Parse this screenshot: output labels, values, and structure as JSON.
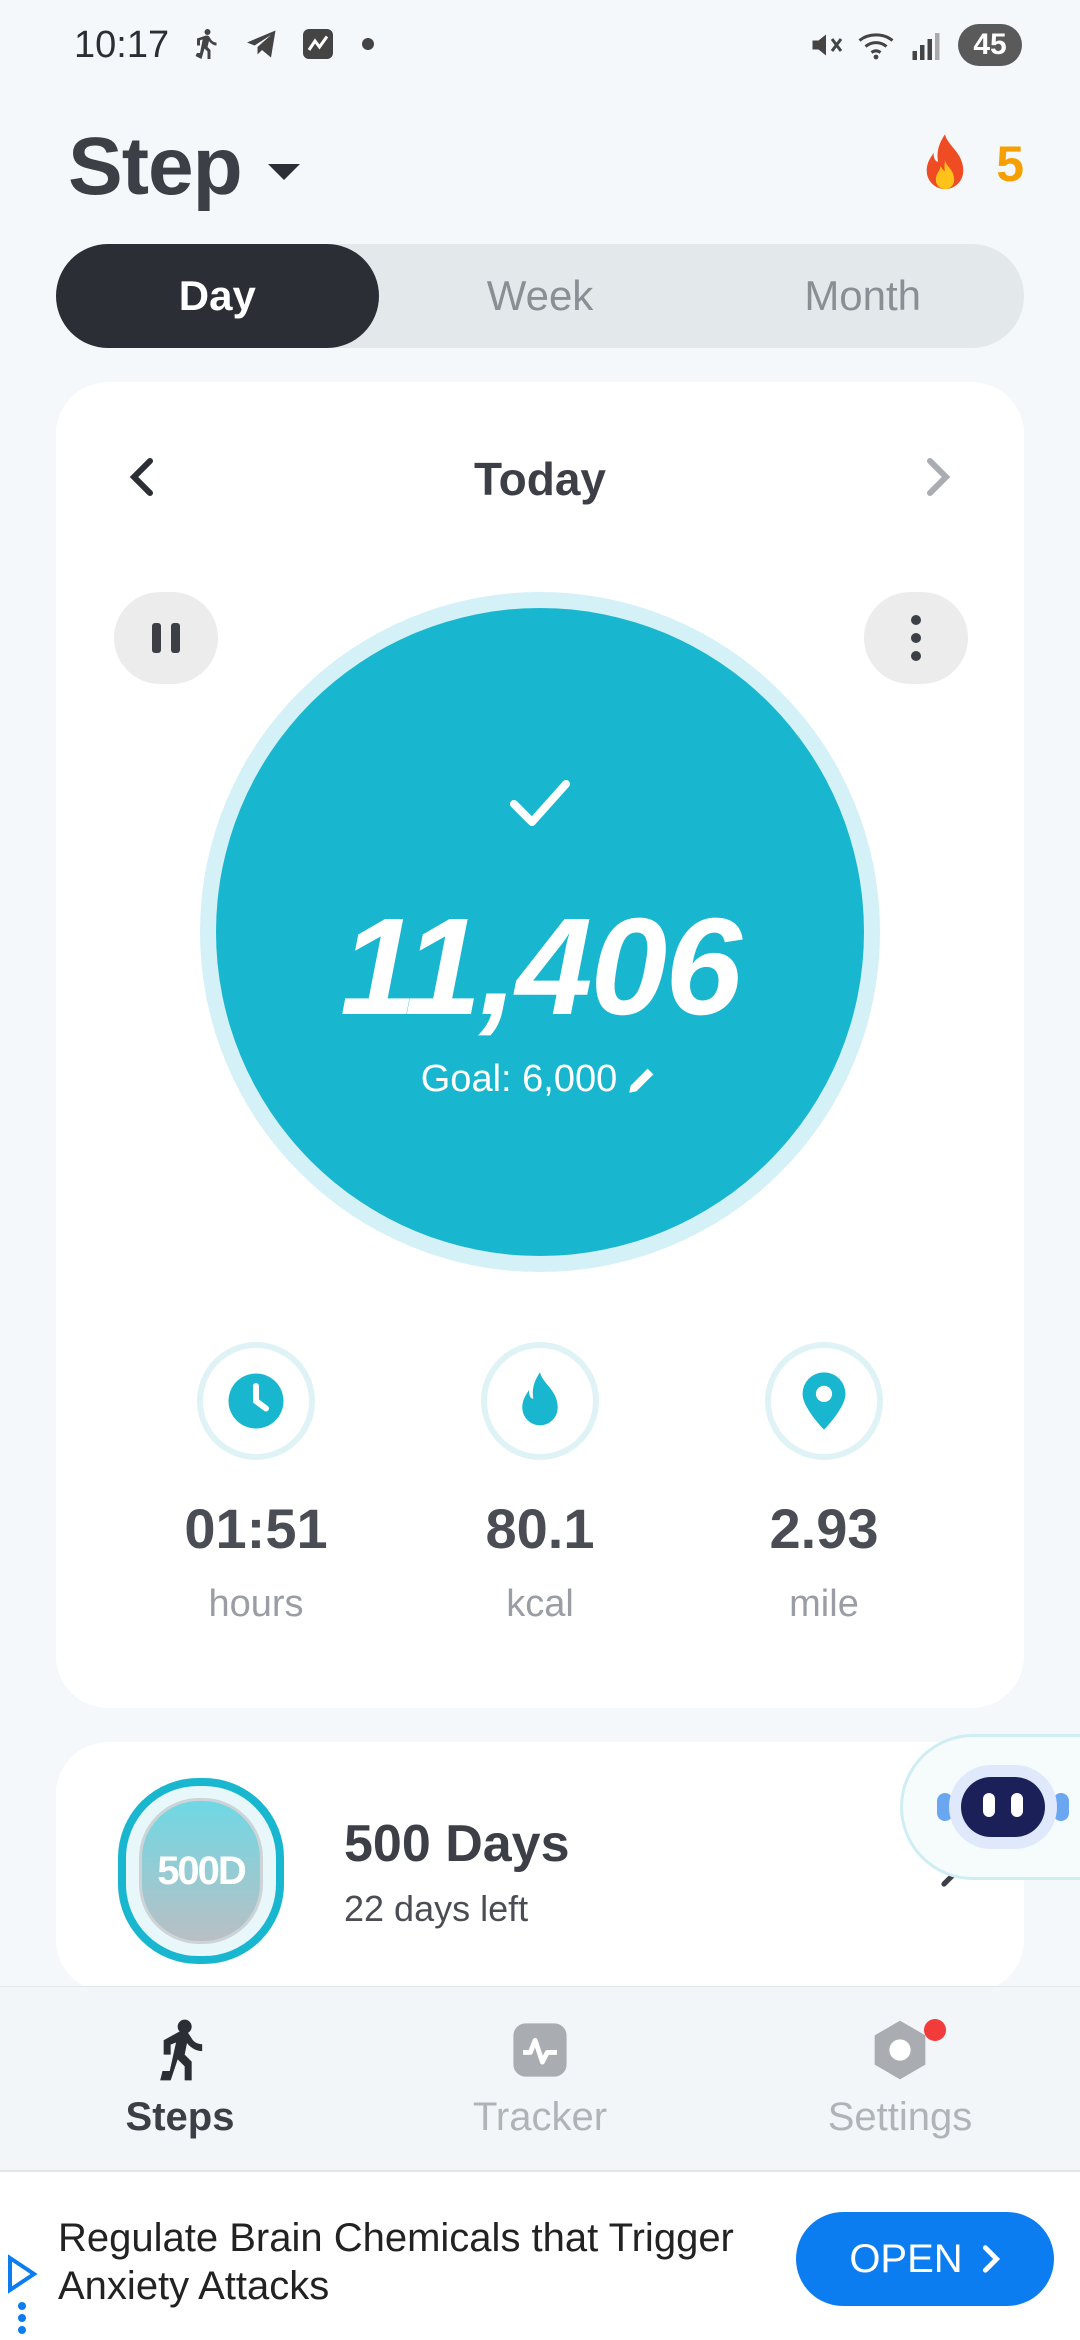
{
  "status_bar": {
    "time": "10:17",
    "battery": "45",
    "network": "6E"
  },
  "header": {
    "title": "Step",
    "streak_count": "5"
  },
  "segments": [
    {
      "label": "Day",
      "active": true
    },
    {
      "label": "Week",
      "active": false
    },
    {
      "label": "Month",
      "active": false
    }
  ],
  "main_card": {
    "date_label": "Today",
    "steps": "11,406",
    "goal": "Goal: 6,000",
    "stats": [
      {
        "icon": "clock-icon",
        "value": "01:51",
        "unit": "hours"
      },
      {
        "icon": "flame-icon",
        "value": "80.1",
        "unit": "kcal"
      },
      {
        "icon": "location-pin-icon",
        "value": "2.93",
        "unit": "mile"
      }
    ]
  },
  "achievement": {
    "badge_text": "500D",
    "title": "500 Days",
    "subtitle": "22 days left"
  },
  "bottom_nav": [
    {
      "label": "Steps",
      "icon": "walking-icon",
      "active": true
    },
    {
      "label": "Tracker",
      "icon": "activity-icon",
      "active": false
    },
    {
      "label": "Settings",
      "icon": "settings-icon",
      "active": false
    }
  ],
  "ad": {
    "text": "Regulate Brain Chemicals that Trigger Anxiety Attacks",
    "button": "OPEN"
  },
  "colors": {
    "accent": "#19b7cf",
    "dark": "#2b2e35",
    "streak": "#f5a000",
    "ad_button": "#0c7cf1"
  }
}
